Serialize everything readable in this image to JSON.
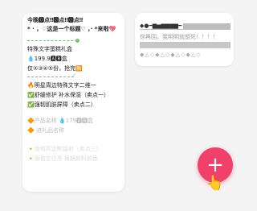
{
  "left_card": {
    "title": "今晚🅾点‼🅾点‼🅾点‼",
    "subtitle": "* · ，♡这是一个标题♡ ，· *来啦💖",
    "product": "特殊文字蛋糕礼盒",
    "price": "💧199.9🅰🅱盒",
    "stock": "仅②③④⑤份，抢完🈚",
    "feature1": "🔥明星周边特殊文字二维一",
    "feature2": "✅舒缓修护 补水保湿（卖点一）",
    "feature3": "✅强韧肌肤屏障（卖点二）",
    "faded_line1": "🔶产品名称 💧179🅰🅱盒",
    "faded_line2": "🔶 进礼品名称",
    "ghost_line1": "🔸香格高定制镭射（卖点三）",
    "ghost_line2": "🔸香格定位黑 根据颜料颜色"
  },
  "right_card": {
    "line1": "◆●━▆▅▆▆▆▆━",
    "line2": "你再回，我明明就想死！！！！",
    "line4": "◆△◇◆△◇◆△◇◆△◇"
  },
  "fab": {
    "icon": "plus-icon",
    "label": "+"
  },
  "cursor": {
    "icon": "pointing-hand-icon",
    "glyph": "👆"
  },
  "colors": {
    "accent": "#f0416a",
    "green": "#7bc27b",
    "background": "#f4f4f4"
  }
}
